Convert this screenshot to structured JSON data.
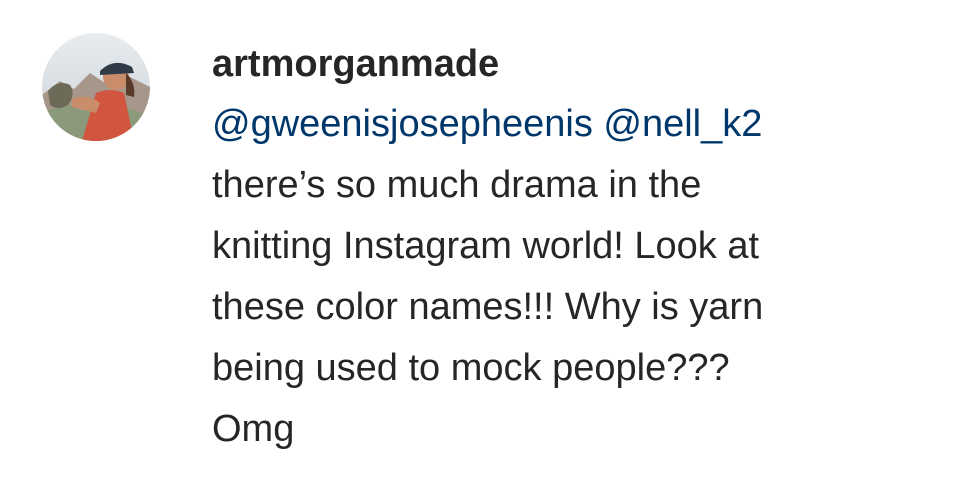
{
  "comment": {
    "username": "artmorganmade",
    "mentions": [
      "@gweenisjosepheenis",
      "@nell_k2"
    ],
    "lines": [
      "there’s so much drama in the",
      "knitting Instagram world! Look at",
      "these color names!!! Why is yarn",
      "being used to mock people???",
      "Omg"
    ]
  },
  "colors": {
    "text": "#262626",
    "mention": "#00376b"
  }
}
